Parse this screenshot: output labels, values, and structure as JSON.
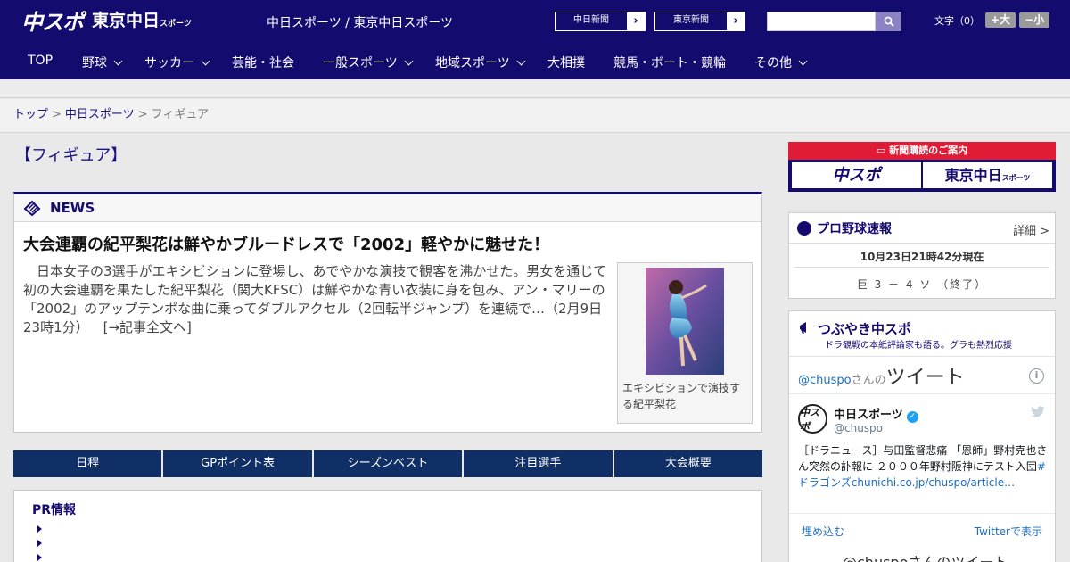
{
  "header": {
    "logo_chuspo": "中スポ",
    "logo_tokyo": "東京中日",
    "logo_tokyo_small": "スポーツ",
    "site_links": "中日スポーツ / 東京中日スポーツ",
    "chunichi_btn": "中日新聞",
    "tokyo_btn": "東京新聞",
    "search_placeholder": "",
    "font_size_label": "文字（0）",
    "font_up": "+大",
    "font_down": "−小"
  },
  "nav": [
    {
      "label": "TOP",
      "dropdown": false
    },
    {
      "label": "野球",
      "dropdown": true
    },
    {
      "label": "サッカー",
      "dropdown": true
    },
    {
      "label": "芸能・社会",
      "dropdown": false
    },
    {
      "label": "一般スポーツ",
      "dropdown": true
    },
    {
      "label": "地域スポーツ",
      "dropdown": true
    },
    {
      "label": "大相撲",
      "dropdown": false
    },
    {
      "label": "競馬・ボート・競輪",
      "dropdown": false
    },
    {
      "label": "その他",
      "dropdown": true
    }
  ],
  "breadcrumb": {
    "home": "トップ",
    "section": "中日スポーツ",
    "current": "フィギュア",
    "sep": ">"
  },
  "page_title": "【フィギュア】",
  "news": {
    "label": "NEWS",
    "title": "大会連覇の紀平梨花は鮮やかブルードレスで「2002」軽やかに魅せた！",
    "body": "　日本女子の3選手がエキシビションに登場し、あでやかな演技で観客を沸かせた。男女を通じて初の大会連覇を果たした紀平梨花（関大KFSC）は鮮やかな青い衣装に身を包み、アン・マリーの「2002」のアップテンポな曲に乗ってダブルアクセル（2回転半ジャンプ）を連続で…（2月9日 23時1分）",
    "more": "[→記事全文へ]",
    "caption": "エキシビションで演技する紀平梨花"
  },
  "tabs": [
    "日程",
    "GPポイント表",
    "シーズンベスト",
    "注目選手",
    "大会概要"
  ],
  "pr": {
    "title": "PR情報"
  },
  "subscribe": {
    "head": "新聞購読のご案内",
    "btn_a": "中スポ",
    "btn_b": "東京中日",
    "btn_b_small": "スポーツ"
  },
  "baseball": {
    "title": "プロ野球速報",
    "detail": "詳細 >",
    "time": "10月23日21時42分現在",
    "score": "巨 3 － 4 ソ （終了）"
  },
  "tweets": {
    "head_title": "つぶやき中スポ",
    "head_sub": "ドラ観戦の本紙評論家も語る。グラも熱烈応援",
    "label_handle": "@chuspo",
    "label_mid": "さんの",
    "label_big": "ツイート",
    "info": "i",
    "avatar": "中スポ",
    "name": "中日スポーツ",
    "check": "✓",
    "handle": "@chuspo",
    "text": "［ドラニュース］与田監督悲痛 「恩師」野村克也さん突然の訃報に ２０００年野村阪神にテスト入団",
    "text_link": "#ドラゴンズchunichi.co.jp/chuspo/article…",
    "embed": "埋め込む",
    "view": "Twitterで表示",
    "footer": "@chuspoさんのツイート"
  },
  "colors": {
    "brand_navy": "#140b6e",
    "tab_blue": "#0f2f66",
    "subscribe_red": "#e01b35",
    "link_blue": "#1b6ec2"
  }
}
